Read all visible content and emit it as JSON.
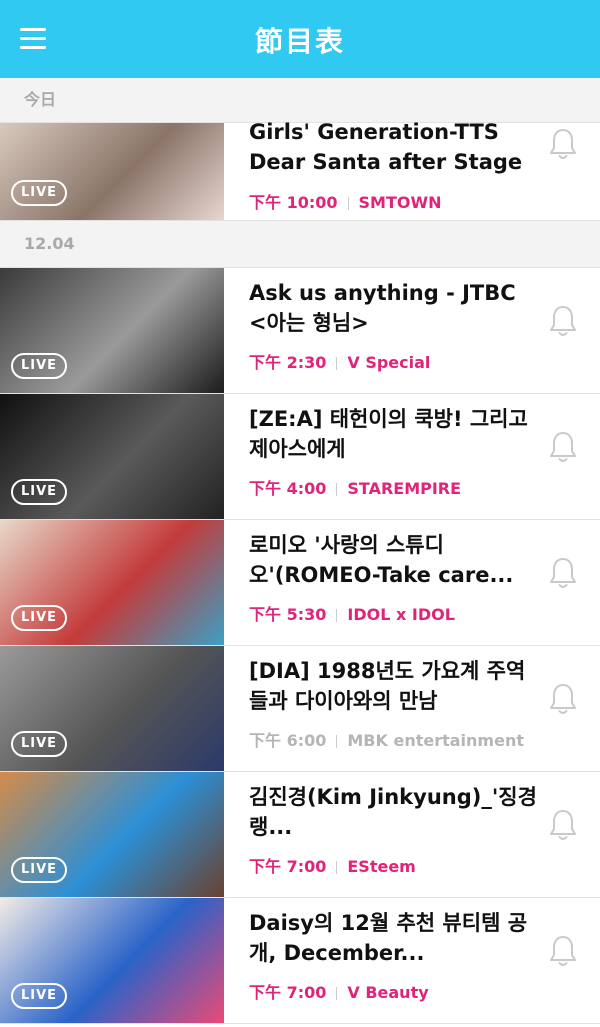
{
  "header": {
    "title": "節目表",
    "menu_icon": "hamburger-menu-icon"
  },
  "sections": [
    {
      "date": "今日",
      "items": [
        {
          "title": "Girls' Generation-TTS Dear Santa after Stage",
          "time": "下午 10:00",
          "channel": "SMTOWN",
          "live": "LIVE",
          "state": "live",
          "thumb": [
            "#d9c9bd",
            "#8a7468",
            "#e8d6cf"
          ]
        }
      ]
    },
    {
      "date": "12.04",
      "items": [
        {
          "title": "Ask us anything - JTBC <아는 형님>",
          "time": "下午 2:30",
          "channel": "V Special",
          "live": "LIVE",
          "state": "live",
          "thumb": [
            "#3a3a3a",
            "#9a9a9a",
            "#1c1c1c"
          ]
        },
        {
          "title": "[ZE:A] 태헌이의 쿡방! 그리고 제아스에게",
          "time": "下午 4:00",
          "channel": "STAREMPIRE",
          "live": "LIVE",
          "state": "live",
          "thumb": [
            "#101010",
            "#5a5a5a",
            "#222"
          ]
        },
        {
          "title": "로미오 '사랑의 스튜디오'(ROMEO-Take care...",
          "time": "下午 5:30",
          "channel": "IDOL x  IDOL",
          "live": "LIVE",
          "state": "live",
          "thumb": [
            "#e7d9c9",
            "#c43b3b",
            "#3aa0c4"
          ]
        },
        {
          "title": "[DIA] 1988년도 가요계 주역들과 다이아와의 만남",
          "time": "下午 6:00",
          "channel": "MBK entertainment",
          "live": "LIVE",
          "state": "past",
          "thumb": [
            "#9a9a9a",
            "#555",
            "#2a3a6a"
          ]
        },
        {
          "title": "김진경(Kim Jinkyung)_'징경랭...",
          "time": "下午 7:00",
          "channel": "ESteem",
          "live": "LIVE",
          "state": "live",
          "thumb": [
            "#d58b48",
            "#2c8fd6",
            "#6a4230"
          ]
        },
        {
          "title": "Daisy의 12월 추천 뷰티템 공개, December...",
          "time": "下午 7:00",
          "channel": "V Beauty",
          "live": "LIVE",
          "state": "live",
          "thumb": [
            "#f2ece6",
            "#2a63c9",
            "#e94a77"
          ]
        }
      ]
    }
  ],
  "colors": {
    "accent": "#30c9f1",
    "time_live": "#e0247a",
    "time_past": "#b5b5b5"
  }
}
